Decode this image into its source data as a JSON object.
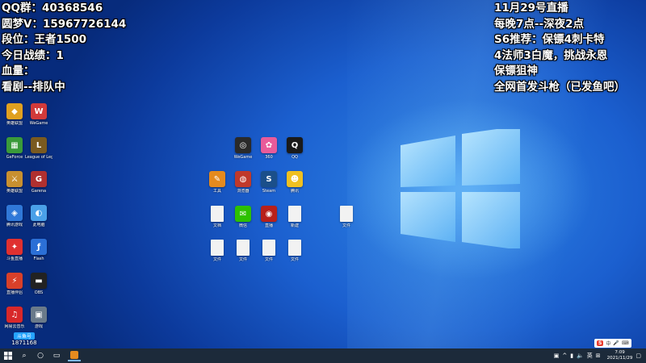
{
  "overlay_left": {
    "line1": "QQ群：40368546",
    "line2": "圆梦V：15967726144",
    "line3": "段位：王者1500",
    "line4": "今日战绩：1",
    "line5": "血量：",
    "line6": "看剧--排队中"
  },
  "overlay_right": {
    "line1": "11月29号直播",
    "line2": "每晚7点--深夜2点",
    "line3": "S6推荐：保镖4刺卡特",
    "line4": "4法师3白魔，挑战永恩",
    "line5": "保镖狙神",
    "line6": "全网首发斗枪（已发鱼吧）"
  },
  "desktop_icons": [
    {
      "label": "英雄联盟",
      "color": "#e0a020",
      "glyph": "◆"
    },
    {
      "label": "WeGame",
      "color": "#d23a3a",
      "glyph": "W"
    },
    {
      "label": "GeForce",
      "color": "#3a9a3a",
      "glyph": "▦"
    },
    {
      "label": "League of Legends",
      "color": "#7a5a20",
      "glyph": "L"
    },
    {
      "label": "英雄联盟",
      "color": "#c89030",
      "glyph": "⚔"
    },
    {
      "label": "Garena",
      "color": "#b03030",
      "glyph": "G"
    },
    {
      "label": "腾讯游戏",
      "color": "#3078d8",
      "glyph": "◈"
    },
    {
      "label": "此电脑",
      "color": "#4aa0e8",
      "glyph": "◐"
    },
    {
      "label": "斗鱼直播",
      "color": "#e03030",
      "glyph": "✦"
    },
    {
      "label": "Flash",
      "color": "#2b6fd6",
      "glyph": "ƒ"
    },
    {
      "label": "直播伴侣",
      "color": "#d8402a",
      "glyph": "⚡"
    },
    {
      "label": "OBS",
      "color": "#222222",
      "glyph": "▬"
    },
    {
      "label": "网易云音乐",
      "color": "#d8282a",
      "glyph": "♫"
    },
    {
      "label": "游戏",
      "color": "#6a7a8a",
      "glyph": "▣"
    }
  ],
  "middle_icons": [
    {
      "label": "WeGame",
      "color": "#2a2a2a",
      "glyph": "◎",
      "type": "app"
    },
    {
      "label": "360",
      "color": "#e85b9a",
      "glyph": "✿",
      "type": "app"
    },
    {
      "label": "QQ",
      "color": "#1a1a1a",
      "glyph": "Q",
      "type": "app"
    },
    {
      "label": "工具",
      "color": "#e58a1f",
      "glyph": "✎",
      "type": "app"
    },
    {
      "label": "浏览器",
      "color": "#c0392b",
      "glyph": "◍",
      "type": "app"
    },
    {
      "label": "Steam",
      "color": "#1b4f8a",
      "glyph": "S",
      "type": "app"
    },
    {
      "label": "腾讯",
      "color": "#f0c020",
      "glyph": "☻",
      "type": "app"
    },
    {
      "label": "文档",
      "color": "#ffffff",
      "glyph": "",
      "type": "doc"
    },
    {
      "label": "微信",
      "color": "#2dc100",
      "glyph": "✉",
      "type": "app"
    },
    {
      "label": "直播",
      "color": "#b8201a",
      "glyph": "◉",
      "type": "app"
    },
    {
      "label": "新建",
      "color": "#ffffff",
      "glyph": "",
      "type": "doc"
    },
    {
      "label": "文件",
      "color": "#ffffff",
      "glyph": "",
      "type": "doc"
    },
    {
      "label": "文件",
      "color": "#ffffff",
      "glyph": "",
      "type": "doc"
    },
    {
      "label": "文件",
      "color": "#ffffff",
      "glyph": "",
      "type": "doc"
    },
    {
      "label": "文件",
      "color": "#ffffff",
      "glyph": "",
      "type": "doc"
    },
    {
      "label": "文件",
      "color": "#ffffff",
      "glyph": "",
      "type": "doc"
    }
  ],
  "live_badge": {
    "tag": "斗鱼号",
    "number": "1871168"
  },
  "ime": {
    "logo": "S",
    "mode": "中"
  },
  "tray": {
    "time": "7:09",
    "date": "2021/11/29"
  },
  "colors": {
    "accent": "#1b5fcf",
    "taskbar": "#1c2a3a",
    "logo_light": "#7fd0ff"
  }
}
